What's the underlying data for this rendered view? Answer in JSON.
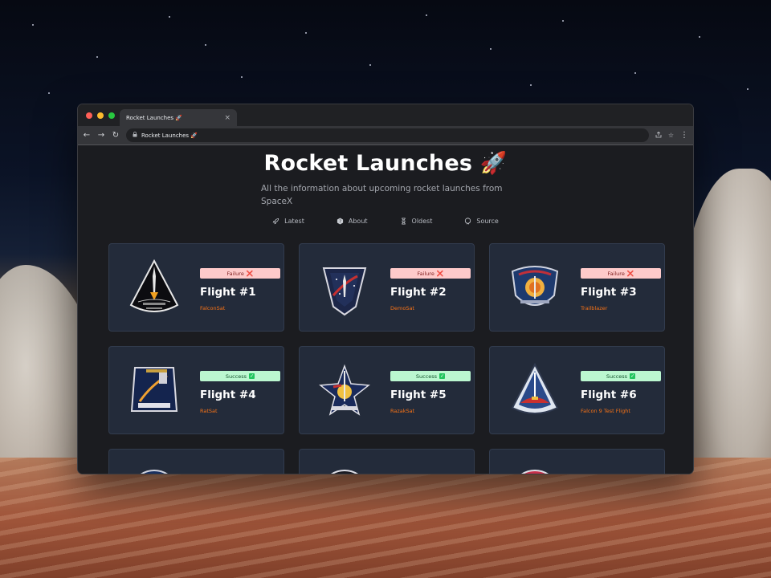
{
  "browser": {
    "tab_title": "Rocket Launches 🚀",
    "tab_close": "×",
    "address": "Rocket Launches 🚀",
    "nav": {
      "back": "←",
      "forward": "→",
      "reload": "↻"
    }
  },
  "header": {
    "title": "Rocket Launches 🚀",
    "subtitle": "All the information about upcoming rocket launches from SpaceX"
  },
  "nav_links": [
    {
      "label": "Latest",
      "icon": "rocket-icon"
    },
    {
      "label": "About",
      "icon": "help-icon"
    },
    {
      "label": "Oldest",
      "icon": "hourglass-icon"
    },
    {
      "label": "Source",
      "icon": "github-icon"
    }
  ],
  "launches": [
    {
      "title": "Flight #1",
      "status": "Failure",
      "status_mark": "❌",
      "payload": "FalconSat"
    },
    {
      "title": "Flight #2",
      "status": "Failure",
      "status_mark": "❌",
      "payload": "DemoSat"
    },
    {
      "title": "Flight #3",
      "status": "Failure",
      "status_mark": "❌",
      "payload": "Trailblazer"
    },
    {
      "title": "Flight #4",
      "status": "Success",
      "status_mark": "✓",
      "payload": "RatSat"
    },
    {
      "title": "Flight #5",
      "status": "Success",
      "status_mark": "✓",
      "payload": "RazakSat"
    },
    {
      "title": "Flight #6",
      "status": "Success",
      "status_mark": "✓",
      "payload": "Falcon 9 Test Flight"
    }
  ],
  "colors": {
    "failure_bg": "#fecaca",
    "success_bg": "#bbf7d0",
    "payload_accent": "#f97316",
    "card_bg": "#232b3a"
  }
}
